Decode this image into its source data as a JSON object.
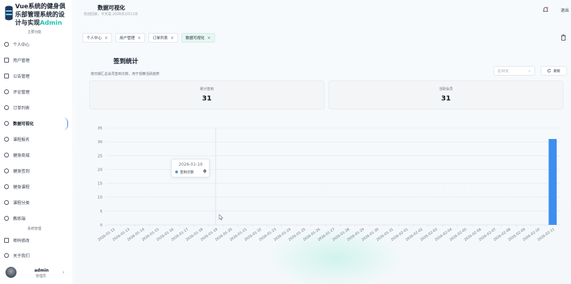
{
  "sidebar": {
    "title_line1": "Vue系统的健身俱",
    "title_line2": "乐部管理系统的设",
    "title_line3_prefix": "计与实现",
    "title_line3_accent": "Admin",
    "main_section": "主要功能",
    "items": [
      {
        "label": "个人中心",
        "icon": "user-icon"
      },
      {
        "label": "用户管理",
        "icon": "users-icon"
      },
      {
        "label": "公告管理",
        "icon": "megaphone-icon"
      },
      {
        "label": "评论管理",
        "icon": "comment-icon"
      },
      {
        "label": "订单列表",
        "icon": "order-icon"
      },
      {
        "label": "数据可视化",
        "icon": "chart-icon",
        "active": true
      },
      {
        "label": "课程报名",
        "icon": "course-icon"
      },
      {
        "label": "健身商城",
        "icon": "shop-icon"
      },
      {
        "label": "健身签到",
        "icon": "checkin-icon"
      },
      {
        "label": "健身课程",
        "icon": "class-icon"
      },
      {
        "label": "课程分类",
        "icon": "category-icon"
      },
      {
        "label": "教练端",
        "icon": "coach-icon"
      }
    ],
    "system_section": "系统管理",
    "system_items": [
      {
        "label": "密码修改",
        "icon": "lock-icon"
      },
      {
        "label": "关于我们",
        "icon": "info-icon"
      }
    ],
    "user": {
      "name": "admin",
      "role": "管理员"
    }
  },
  "header": {
    "title": "数据可视化",
    "subtitle": "欢迎回来，今天是 2026年2月11日",
    "logout": "退出"
  },
  "tabs": [
    {
      "label": "个人中心"
    },
    {
      "label": "用户管理"
    },
    {
      "label": "订单列表"
    },
    {
      "label": "数据可视化",
      "active": true
    }
  ],
  "card": {
    "title": "签到统计",
    "description": "按日期汇总会员签到次数，用于观察活跃趋势",
    "range_placeholder": "近30天",
    "refresh_label": "刷新",
    "stats": [
      {
        "label": "累计签到",
        "value": "31"
      },
      {
        "label": "活跃会员",
        "value": "31"
      }
    ]
  },
  "tooltip": {
    "date": "2026-01-19",
    "series": "签到次数",
    "value": "0"
  },
  "colors": {
    "accent": "#22c3b5",
    "bar": "#3d8fef",
    "active_tab": "#e8f7f2"
  },
  "chart_data": {
    "type": "bar",
    "series": [
      {
        "name": "签到次数",
        "values": [
          0,
          0,
          0,
          0,
          0,
          0,
          0,
          0,
          0,
          0,
          0,
          0,
          0,
          0,
          0,
          0,
          0,
          0,
          0,
          0,
          0,
          0,
          0,
          0,
          0,
          0,
          0,
          0,
          0,
          0,
          31
        ]
      }
    ],
    "categories": [
      "2026-01-12",
      "2026-01-13",
      "2026-01-14",
      "2026-01-15",
      "2026-01-16",
      "2026-01-17",
      "2026-01-18",
      "2026-01-19",
      "2026-01-20",
      "2026-01-21",
      "2026-01-22",
      "2026-01-23",
      "2026-01-24",
      "2026-01-25",
      "2026-01-26",
      "2026-01-27",
      "2026-01-28",
      "2026-01-29",
      "2026-01-30",
      "2026-01-31",
      "2026-02-01",
      "2026-02-02",
      "2026-02-03",
      "2026-02-04",
      "2026-02-05",
      "2026-02-06",
      "2026-02-07",
      "2026-02-08",
      "2026-02-09",
      "2026-02-10",
      "2026-02-11"
    ],
    "yticks": [
      0,
      5,
      10,
      15,
      20,
      25,
      30,
      35
    ],
    "ylim": [
      0,
      35
    ],
    "grid": true,
    "title": "",
    "xlabel": "",
    "ylabel": ""
  }
}
